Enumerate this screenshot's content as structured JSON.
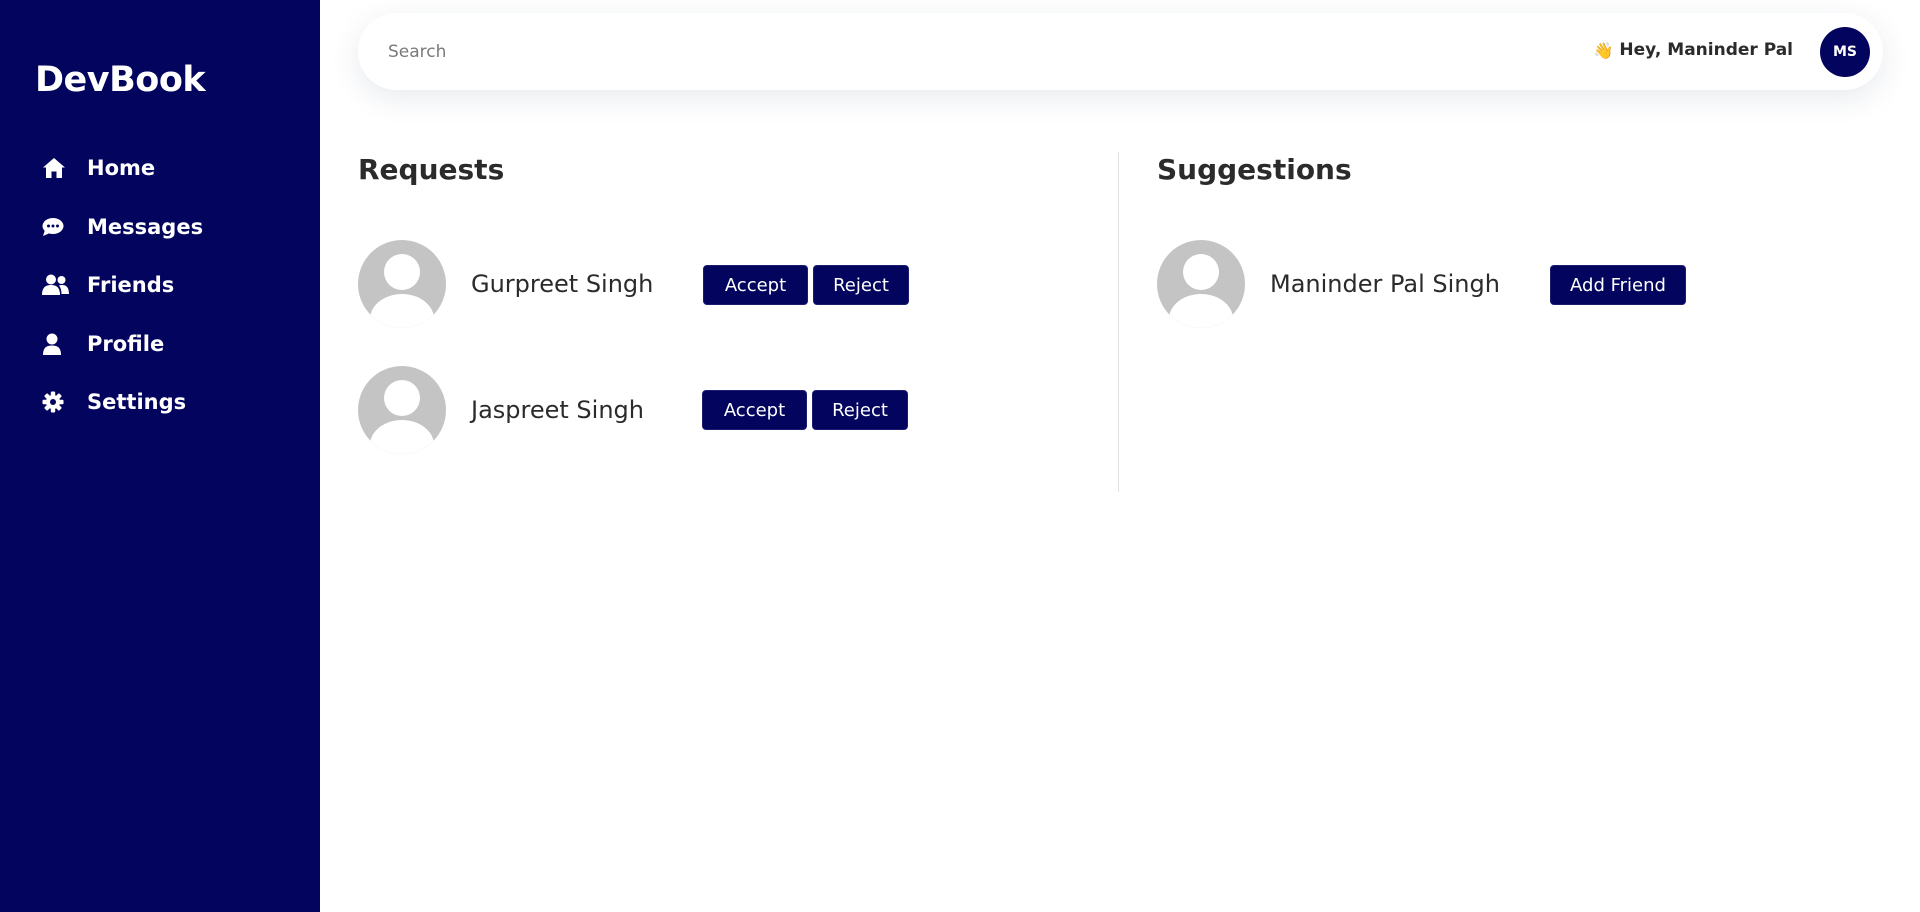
{
  "app": {
    "brand": "DevBook"
  },
  "nav": [
    {
      "label": "Home",
      "icon": "home-icon"
    },
    {
      "label": "Messages",
      "icon": "chat-icon"
    },
    {
      "label": "Friends",
      "icon": "users-icon"
    },
    {
      "label": "Profile",
      "icon": "user-icon"
    },
    {
      "label": "Settings",
      "icon": "gear-icon"
    }
  ],
  "topbar": {
    "search_placeholder": "Search",
    "greeting_emoji": "👋",
    "greeting": "Hey, Maninder Pal",
    "avatar_initials": "MS"
  },
  "requests": {
    "title": "Requests",
    "items": [
      {
        "name": "Gurpreet Singh",
        "accept_label": "Accept",
        "reject_label": "Reject"
      },
      {
        "name": "Jaspreet Singh",
        "accept_label": "Accept",
        "reject_label": "Reject"
      }
    ]
  },
  "suggestions": {
    "title": "Suggestions",
    "items": [
      {
        "name": "Maninder Pal Singh",
        "add_label": "Add Friend"
      }
    ]
  },
  "colors": {
    "primary": "#03045e",
    "avatar_placeholder": "#c4c4c4",
    "text": "#2b2b2b"
  }
}
